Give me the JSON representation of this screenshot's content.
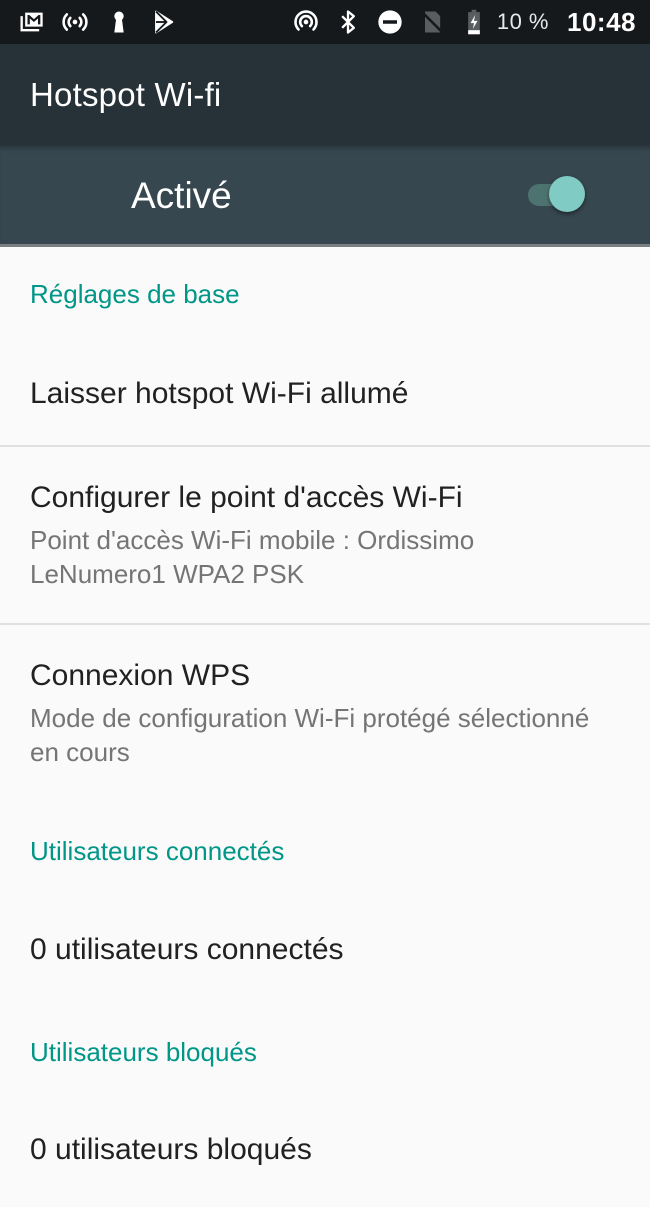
{
  "status_bar": {
    "left_icons": [
      "gmail-icon",
      "hotspot-broadcast-icon",
      "keyhole-icon",
      "play-store-icon"
    ],
    "right_icons": [
      "hotspot-icon",
      "bluetooth-icon",
      "do-not-disturb-icon",
      "no-sim-icon",
      "battery-charging-icon"
    ],
    "battery": "10 %",
    "time": "10:48"
  },
  "app_bar": {
    "title": "Hotspot Wi-fi"
  },
  "master_switch": {
    "label": "Activé",
    "state": true,
    "accent_color": "#80cbc4"
  },
  "sections": [
    {
      "header": "Réglages de base",
      "items": [
        {
          "title": "Laisser hotspot Wi-Fi allumé"
        },
        {
          "title": "Configurer le point d'accès Wi-Fi",
          "summary": "Point d'accès Wi-Fi mobile : Ordissimo LeNumero1 WPA2 PSK"
        },
        {
          "title": "Connexion WPS",
          "summary": "Mode de configuration Wi-Fi protégé sélectionné en cours"
        }
      ]
    },
    {
      "header": "Utilisateurs connectés",
      "items": [
        {
          "title": "0 utilisateurs connectés"
        }
      ]
    },
    {
      "header": "Utilisateurs bloqués",
      "items": [
        {
          "title": "0 utilisateurs bloqués"
        }
      ]
    }
  ],
  "colors": {
    "accent": "#009688",
    "app_bar": "#263238",
    "switch_bar": "#37474f",
    "background": "#fafafa"
  }
}
